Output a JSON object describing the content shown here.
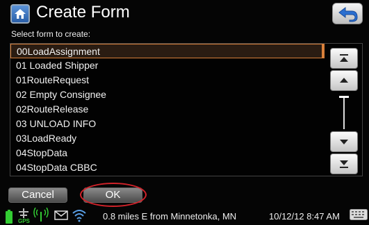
{
  "header": {
    "title": "Create Form",
    "home_icon": "home-icon",
    "back_icon": "back-arrow-icon"
  },
  "prompt": "Select form to create:",
  "forms": [
    "00LoadAssignment",
    "01 Loaded Shipper",
    "01RouteRequest",
    "02 Empty Consignee",
    "02RouteRelease",
    "03 UNLOAD INFO",
    "03LoadReady",
    "04StopData",
    "04StopData CBBC"
  ],
  "selected_index": 0,
  "scroll_buttons": {
    "top": "scroll-to-top-icon",
    "up": "scroll-up-icon",
    "down": "scroll-down-icon",
    "bottom": "scroll-to-bottom-icon"
  },
  "buttons": {
    "cancel": "Cancel",
    "ok": "OK"
  },
  "status": {
    "location": "0.8 miles E from Minnetonka, MN",
    "datetime": "10/12/12 8:47 AM",
    "icons": [
      "battery-icon",
      "gps-icon",
      "antenna-icon",
      "mail-icon",
      "wifi-icon",
      "keyboard-icon"
    ],
    "gps_label": "GPS"
  },
  "colors": {
    "selection": "#d9803a",
    "annotation": "#d2232a",
    "accent_blue": "#2a5fa8"
  }
}
